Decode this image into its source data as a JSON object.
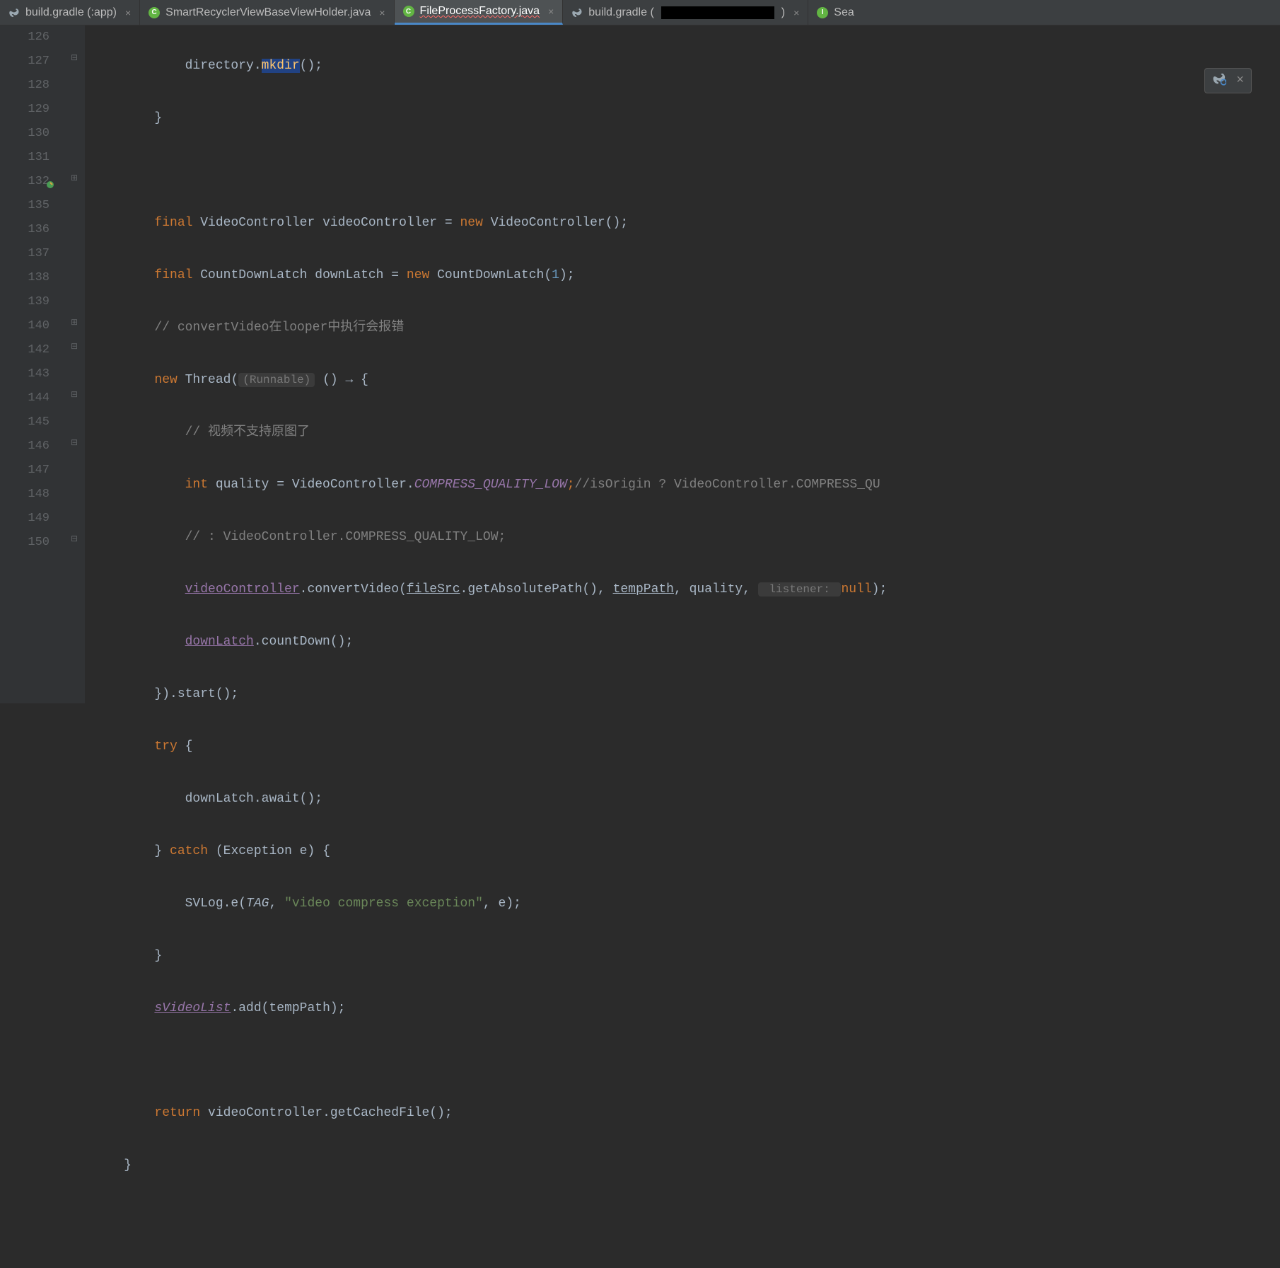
{
  "tabs": [
    {
      "label": "build.gradle (:app)",
      "icon": "elephant",
      "active": false
    },
    {
      "label": "SmartRecyclerViewBaseViewHolder.java",
      "icon": "java",
      "active": false
    },
    {
      "label": "FileProcessFactory.java",
      "icon": "java",
      "active": true,
      "wavy": true
    },
    {
      "label": "build.gradle (",
      "suffix": ")",
      "icon": "elephant",
      "redacted": true,
      "active": false
    },
    {
      "label": "Sea",
      "icon": "interface",
      "active": false,
      "truncated": true
    }
  ],
  "lineNumbers": [
    "126",
    "127",
    "128",
    "129",
    "130",
    "131",
    "132",
    "135",
    "136",
    "137",
    "138",
    "139",
    "140",
    "142",
    "143",
    "144",
    "145",
    "146",
    "147",
    "148",
    "149",
    "150"
  ],
  "gutterMarkers": {
    "132": "vcs-changed"
  },
  "foldMarkers": {
    "127": "⊟",
    "132": "⊞",
    "140": "⊞",
    "142": "⊟",
    "144": "⊟",
    "146": "⊟",
    "150": "⊟"
  },
  "code": {
    "l126": {
      "indent": "            ",
      "obj": "directory",
      "dot": ".",
      "method": "mkdir",
      "hl": "mkdir",
      "tail": "();"
    },
    "l127": {
      "text": "        }"
    },
    "l128": {
      "text": ""
    },
    "l129": {
      "indent": "        ",
      "kw1": "final",
      "type": " VideoController videoController = ",
      "kw2": "new",
      "ctor": " VideoController();"
    },
    "l130": {
      "indent": "        ",
      "kw1": "final",
      "type": " CountDownLatch downLatch = ",
      "kw2": "new",
      "ctor": " CountDownLatch(",
      "num": "1",
      "tail": ");"
    },
    "l131": {
      "indent": "        ",
      "comment": "// convertVideo在looper中执行会报错"
    },
    "l132": {
      "indent": "        ",
      "kw": "new",
      "sp": " Thread(",
      "hint": "(Runnable)",
      "lambda": " () → {"
    },
    "l135": {
      "indent": "            ",
      "comment": "// 视频不支持原图了"
    },
    "l136": {
      "indent": "            ",
      "kw": "int",
      "rest": " quality = VideoController.",
      "const": "COMPRESS_QUALITY_LOW",
      "semi": ";",
      "comment": "//isOrigin ? VideoController.COMPRESS_QU"
    },
    "l137": {
      "indent": "            ",
      "comment": "// : VideoController.COMPRESS_QUALITY_LOW;"
    },
    "l138": {
      "indent": "            ",
      "field": "videoController",
      "dot": ".convertVideo(",
      "p1": "fileSrc",
      "mid": ".getAbsolutePath(), ",
      "p2": "tempPath",
      "mid2": ", quality, ",
      "hint": " listener: ",
      "kw": "null",
      "tail": ");"
    },
    "l139": {
      "indent": "            ",
      "field": "downLatch",
      "tail": ".countDown();"
    },
    "l140": {
      "text": "        }).start();"
    },
    "l142": {
      "indent": "        ",
      "kw": "try",
      "tail": " {"
    },
    "l143": {
      "text": "            downLatch.await();"
    },
    "l144": {
      "indent": "        } ",
      "kw": "catch",
      "tail": " (Exception e) {"
    },
    "l145": {
      "indent": "            SVLog.e(",
      "italic": "TAG",
      "mid": ", ",
      "str": "\"video compress exception\"",
      "tail": ", e);"
    },
    "l146": {
      "text": "        }"
    },
    "l147": {
      "indent": "        ",
      "field": "sVideoList",
      "tail": ".add(tempPath);"
    },
    "l148": {
      "text": ""
    },
    "l149": {
      "indent": "        ",
      "kw": "return",
      "tail": " videoController.getCachedFile();"
    },
    "l150": {
      "text": "    }"
    }
  },
  "floatingToolbar": {
    "icon1": "elephant-refresh",
    "icon2": "close"
  }
}
